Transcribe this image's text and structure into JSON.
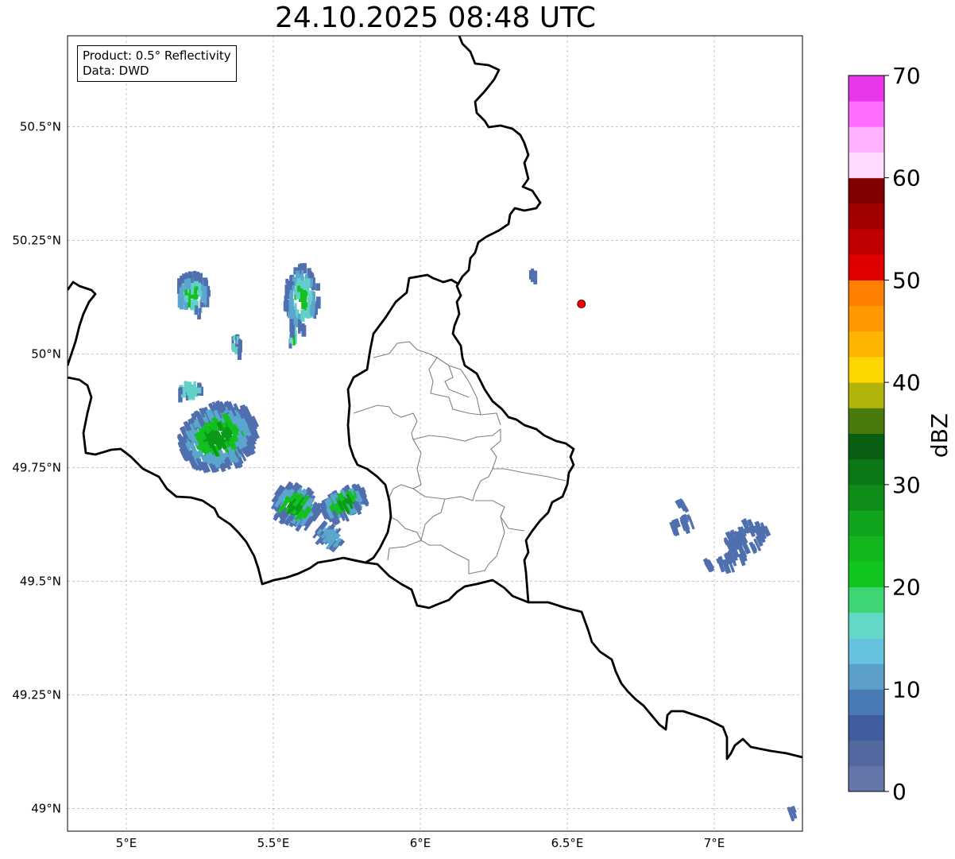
{
  "title": "24.10.2025 08:48 UTC",
  "info": {
    "product": "Product: 0.5° Reflectivity",
    "data": "Data: DWD"
  },
  "map": {
    "lon_range": [
      4.8,
      7.3
    ],
    "lat_range": [
      48.95,
      50.7
    ],
    "x_ticks": [
      {
        "value": 5.0,
        "label": "5°E"
      },
      {
        "value": 5.5,
        "label": "5.5°E"
      },
      {
        "value": 6.0,
        "label": "6°E"
      },
      {
        "value": 6.5,
        "label": "6.5°E"
      },
      {
        "value": 7.0,
        "label": "7°E"
      }
    ],
    "y_ticks": [
      {
        "value": 50.5,
        "label": "50.5°N"
      },
      {
        "value": 50.25,
        "label": "50.25°N"
      },
      {
        "value": 50.0,
        "label": "50°N"
      },
      {
        "value": 49.75,
        "label": "49.75°N"
      },
      {
        "value": 49.5,
        "label": "49.5°N"
      },
      {
        "value": 49.25,
        "label": "49.25°N"
      },
      {
        "value": 49.0,
        "label": "49°N"
      }
    ],
    "grid": true,
    "radar_site": {
      "lon": 6.548,
      "lat": 50.11,
      "color": "#ff0000"
    }
  },
  "colorbar": {
    "label": "dBZ",
    "min": 0,
    "max": 70,
    "tick_values": [
      0,
      10,
      20,
      30,
      40,
      50,
      60,
      70
    ],
    "tick_labels": [
      "0",
      "10",
      "20",
      "30",
      "40",
      "50",
      "60",
      "70"
    ],
    "colors": [
      "#6477a8",
      "#53689f",
      "#405da0",
      "#4a7ab5",
      "#5b9ec8",
      "#67c2df",
      "#64d8c6",
      "#3ed675",
      "#11c61f",
      "#12b81e",
      "#10a51c",
      "#0e8e19",
      "#0c7717",
      "#085f12",
      "#4a7a0b",
      "#afb30a",
      "#ffd700",
      "#ffb400",
      "#ff9800",
      "#ff7f00",
      "#e10000",
      "#c00000",
      "#a00000",
      "#800000",
      "#ffdbff",
      "#ffb3ff",
      "#ff6dff",
      "#ea36ea"
    ]
  },
  "echo_colors": {
    "weak": "#4f6fae",
    "light": "#5aa6cc",
    "cyan": "#62d0c8",
    "green": "#12c020",
    "dark_green": "#0a9a18"
  }
}
